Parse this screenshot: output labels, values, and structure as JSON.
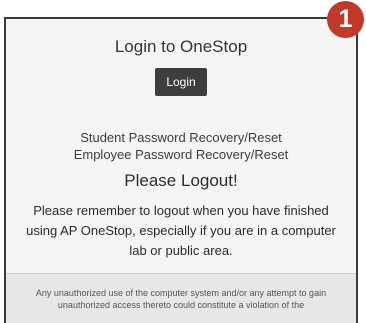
{
  "login": {
    "title": "Login to OneStop",
    "button_label": "Login"
  },
  "recovery": {
    "student": "Student Password Recovery/Reset",
    "employee": "Employee Password Recovery/Reset"
  },
  "logout": {
    "heading": "Please Logout!",
    "message": "Please remember to logout when you have finished using AP OneStop, especially if you are in a computer lab or public area."
  },
  "notice": {
    "text": "Any unauthorized use of the computer system and/or any attempt to gain unauthorized access thereto could constitute a violation of the"
  },
  "badge": {
    "number": "1",
    "color": "#c0392b"
  }
}
